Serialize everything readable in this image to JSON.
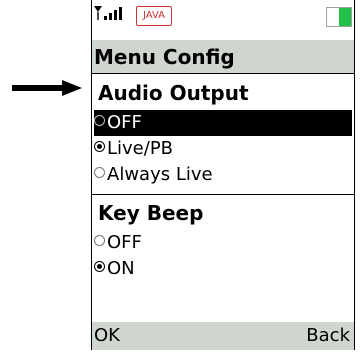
{
  "annotation": {
    "icon": "arrow-right-icon"
  },
  "status": {
    "signal_icon": "signal-strength-icon",
    "java_badge": "JAVA",
    "battery_icon": "battery-icon",
    "battery_level": 0.5,
    "battery_color": "#22c24a"
  },
  "screen": {
    "title": "Menu Config"
  },
  "sections": {
    "audio_output": {
      "title": "Audio Output",
      "options": [
        {
          "label": "OFF",
          "checked": false,
          "highlighted": true
        },
        {
          "label": "Live/PB",
          "checked": true,
          "highlighted": false
        },
        {
          "label": "Always Live",
          "checked": false,
          "highlighted": false
        }
      ]
    },
    "key_beep": {
      "title": "Key Beep",
      "options": [
        {
          "label": "OFF",
          "checked": false
        },
        {
          "label": "ON",
          "checked": true
        }
      ]
    }
  },
  "softkeys": {
    "left": "OK",
    "right": "Back"
  },
  "colors": {
    "title_bar_bg": "#cfd6cf",
    "selection_bg": "#000000",
    "selection_text": "#ffffff"
  }
}
